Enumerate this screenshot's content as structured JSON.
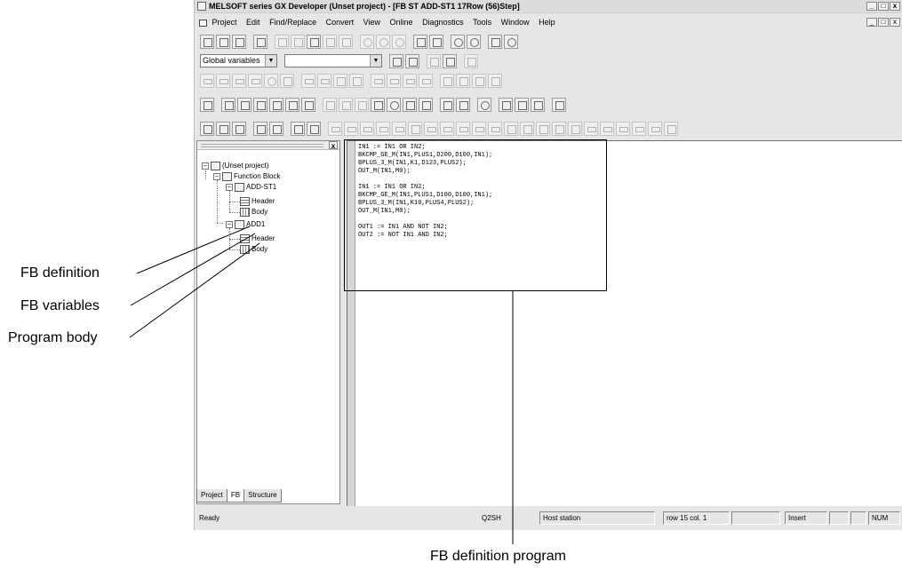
{
  "window": {
    "title": "MELSOFT series GX Developer (Unset project) - [FB ST ADD-ST1  17Row (56)Step]",
    "title_controls": [
      "_",
      "□",
      "x"
    ]
  },
  "menubar": {
    "items": [
      "Project",
      "Edit",
      "Find/Replace",
      "Convert",
      "View",
      "Online",
      "Diagnostics",
      "Tools",
      "Window",
      "Help"
    ],
    "doc_controls": [
      "_",
      "□",
      "x"
    ]
  },
  "toolbar": {
    "variables_combo": "Global variables",
    "second_combo": ""
  },
  "tree": {
    "root": "(Unset project)",
    "function_block": "Function Block",
    "fb1": "ADD-ST1",
    "fb1_header": "Header",
    "fb1_body": "Body",
    "fb2": "ADD1",
    "fb2_header": "Header",
    "fb2_body": "Body",
    "close": "x"
  },
  "tabs": [
    "Project",
    "FB",
    "Structure"
  ],
  "code": [
    "IN1 := IN1 OR IN2;",
    "BKCMP_GE_M(IN1,PLUS1,D200,D100,IN1);",
    "BPLUS_3_M(IN1,K1,D123,PLUS2);",
    "OUT_M(IN1,M0);",
    "",
    "IN1 := IN1 OR IN2;",
    "BKCMP_GE_M(IN1,PLUS1,D100,D100,IN1);",
    "BPLUS_3_M(IN1,K10,PLUS4,PLUS2);",
    "OUT_M(IN1,M0);",
    "",
    "OUT1 := IN1 AND NOT IN2;",
    "OUT2 := NOT IN1 AND IN2;"
  ],
  "status": {
    "ready": "Ready",
    "cpu": "Q2SH",
    "station": "Host station",
    "position": "row   15 col.  1",
    "mode": "Insert",
    "num": "NUM"
  },
  "callouts": {
    "fb_definition": "FB definition",
    "fb_variables": "FB variables",
    "program_body": "Program body",
    "fb_definition_program": "FB definition program"
  }
}
